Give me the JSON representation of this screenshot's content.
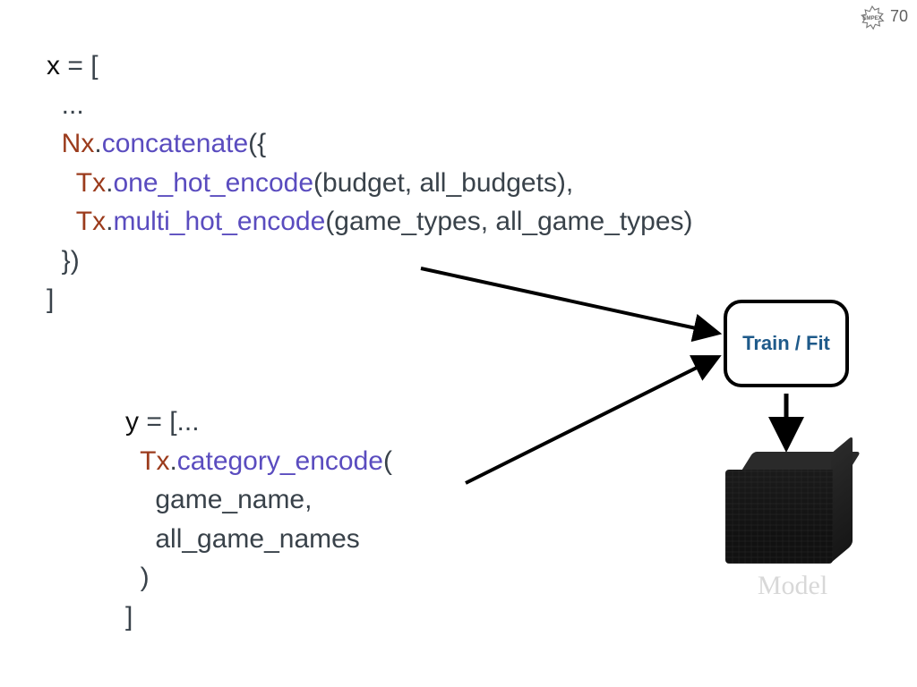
{
  "meta": {
    "slide_number": "70",
    "logo_name": "empex-logo"
  },
  "code_x": {
    "l1_var": "x",
    "l1_eq_open": " = [",
    "l2_dots": "  ...",
    "l3_mod": "  Nx",
    "l3_dot": ".",
    "l3_func": "concatenate",
    "l3_open": "({",
    "l4_mod": "    Tx",
    "l4_dot": ".",
    "l4_func": "one_hot_encode",
    "l4_args": "(budget, all_budgets),",
    "l5_mod": "    Tx",
    "l5_dot": ".",
    "l5_func": "multi_hot_encode",
    "l5_args": "(game_types, all_game_types)",
    "l6_close": "  })",
    "l7_close": "]"
  },
  "code_y": {
    "l1_var": "y",
    "l1_eq_open": " = [...",
    "l2_mod": "  Tx",
    "l2_dot": ".",
    "l2_func": "category_encode",
    "l2_open": "(",
    "l3_arg": "    game_name,",
    "l4_arg": "    all_game_names",
    "l5_close_paren": "  )",
    "l6_close_bracket": "]"
  },
  "trainbox": {
    "label": "Train / Fit"
  },
  "model": {
    "label": "Model"
  },
  "colors": {
    "module": "#9b3b1c",
    "function": "#5a4cbf",
    "text": "#39424a",
    "train_text": "#1e5a8a",
    "model_label": "#d8d8d8"
  }
}
